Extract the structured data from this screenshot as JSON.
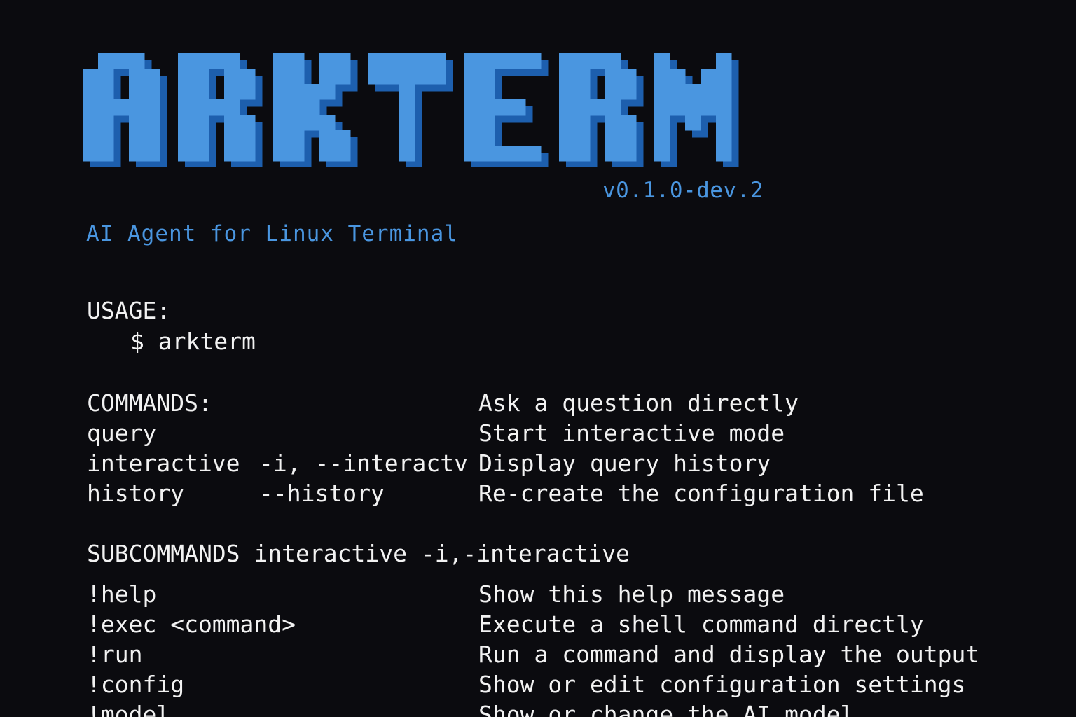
{
  "logo": {
    "text": "ARKTERM",
    "letters": [
      "A",
      "R",
      "K",
      "T",
      "E",
      "R",
      "M"
    ],
    "color": "#4a96e0",
    "shadow_color": "#1d5fae"
  },
  "version": "v0.1.0-dev.2",
  "tagline": "AI Agent for Linux Terminal",
  "usage": {
    "heading": "USAGE:",
    "command": "$ arkterm"
  },
  "commands": {
    "heading": "COMMANDS:",
    "heading_desc": "Ask a question directly",
    "rows": [
      {
        "name": "query",
        "flags": "",
        "desc": "Start interactive mode"
      },
      {
        "name": "interactive",
        "flags": "-i, --interactv",
        "desc": "Display query history"
      },
      {
        "name": "history",
        "flags": "--history",
        "desc": "Re-create the configuration file"
      }
    ]
  },
  "subcommands": {
    "heading": "SUBCOMMANDS interactive -i,-interactive",
    "rows": [
      {
        "name": "!help",
        "desc": "Show this help message"
      },
      {
        "name": "!exec <command>",
        "desc": "Execute a shell command directly"
      },
      {
        "name": "!run",
        "desc": "Run a command and display the output"
      },
      {
        "name": "!config",
        "desc": "Show or edit configuration settings"
      },
      {
        "name": "!model",
        "desc": "Show or change the AI model"
      }
    ]
  },
  "colors": {
    "background": "#0b0b0f",
    "text": "#f2f2f2",
    "accent": "#4a96e0"
  }
}
